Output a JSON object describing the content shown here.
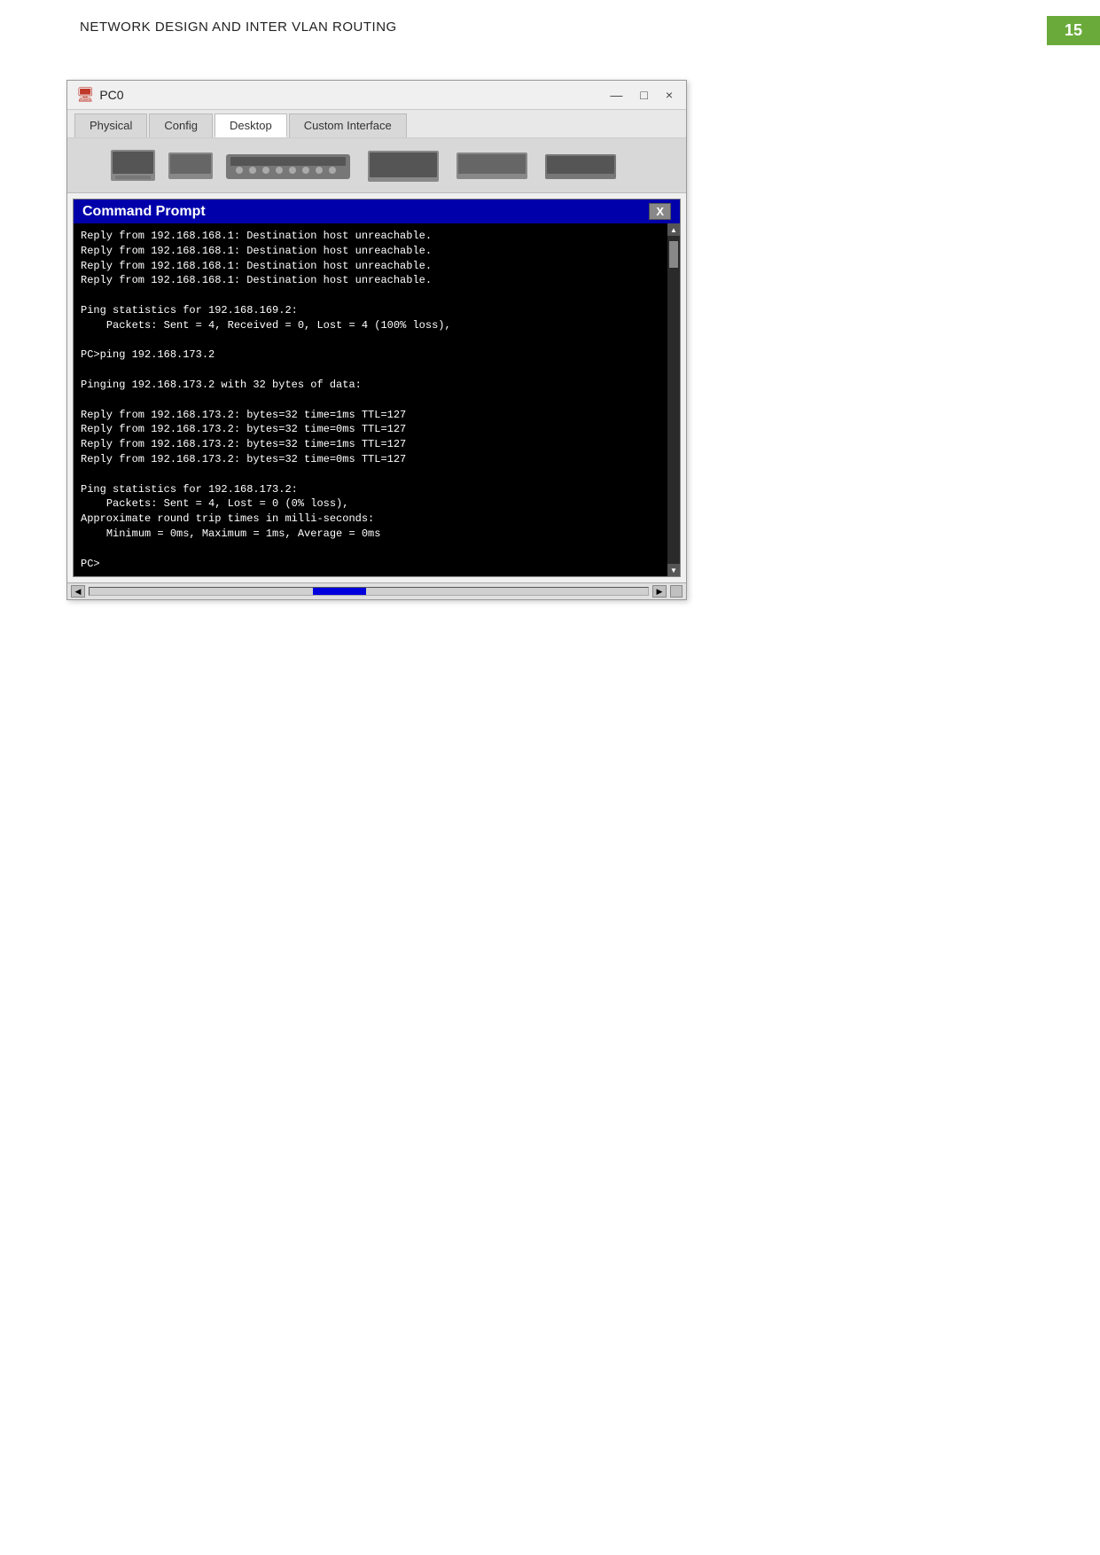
{
  "page": {
    "title": "NETWORK DESIGN AND INTER VLAN ROUTING",
    "number": "15"
  },
  "window": {
    "title": "PC0",
    "icon": "🖥",
    "controls": {
      "minimize": "—",
      "maximize": "□",
      "close": "×"
    }
  },
  "tabs": [
    {
      "label": "Physical",
      "active": false
    },
    {
      "label": "Config",
      "active": false
    },
    {
      "label": "Desktop",
      "active": true
    },
    {
      "label": "Custom Interface",
      "active": false
    }
  ],
  "command_prompt": {
    "title": "Command Prompt",
    "close_btn": "X",
    "content_lines": [
      "Reply from 192.168.168.1: Destination host unreachable.",
      "Reply from 192.168.168.1: Destination host unreachable.",
      "Reply from 192.168.168.1: Destination host unreachable.",
      "Reply from 192.168.168.1: Destination host unreachable.",
      "",
      "Ping statistics for 192.168.169.2:",
      "    Packets: Sent = 4, Received = 0, Lost = 4 (100% loss),",
      "",
      "PC>ping 192.168.173.2",
      "",
      "Pinging 192.168.173.2 with 32 bytes of data:",
      "",
      "Reply from 192.168.173.2: bytes=32 time=1ms TTL=127",
      "Reply from 192.168.173.2: bytes=32 time=0ms TTL=127",
      "Reply from 192.168.173.2: bytes=32 time=1ms TTL=127",
      "Reply from 192.168.173.2: bytes=32 time=0ms TTL=127",
      "",
      "Ping statistics for 192.168.173.2:",
      "    Packets: Sent = 4, Lost = 0 (0% loss),",
      "Approximate round trip times in milli-seconds:",
      "    Minimum = 0ms, Maximum = 1ms, Average = 0ms",
      "",
      "PC>"
    ]
  }
}
